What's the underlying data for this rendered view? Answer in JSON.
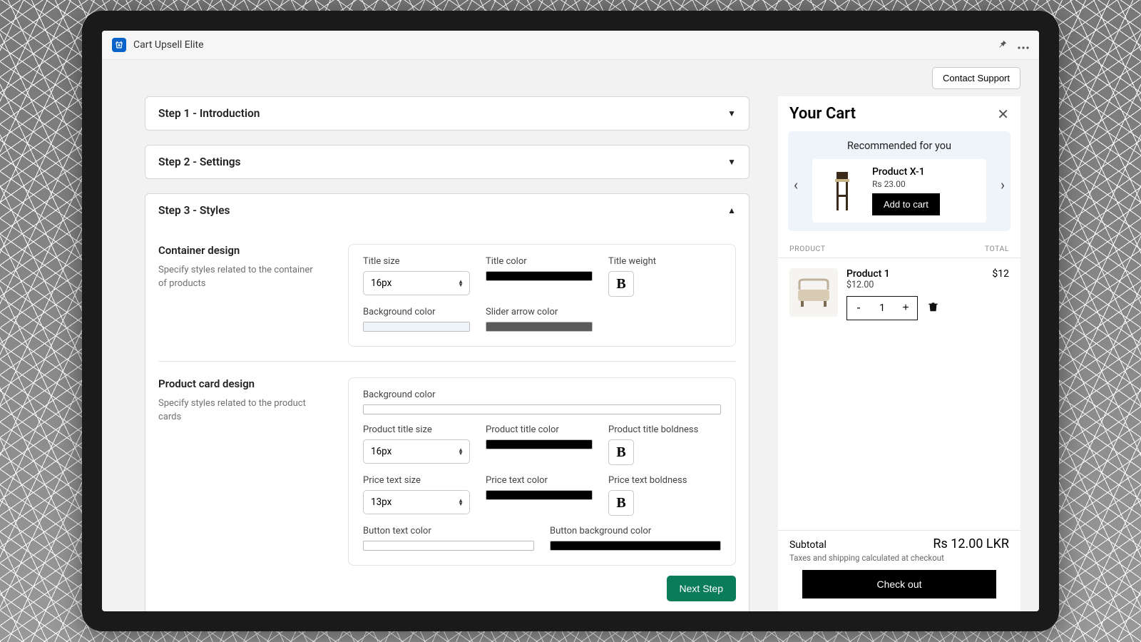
{
  "app": {
    "title": "Cart Upsell Elite"
  },
  "contactSupport": "Contact Support",
  "steps": {
    "s1": "Step 1 - Introduction",
    "s2": "Step 2 - Settings",
    "s3": "Step 3 - Styles"
  },
  "container": {
    "title": "Container design",
    "desc": "Specify styles related to the container of products",
    "fields": {
      "titleSize": {
        "label": "Title size",
        "value": "16px"
      },
      "titleColor": {
        "label": "Title color",
        "value": "#000000"
      },
      "titleWeight": {
        "label": "Title weight"
      },
      "bgColor": {
        "label": "Background color",
        "value": "#eff4fb"
      },
      "arrowColor": {
        "label": "Slider arrow color",
        "value": "#5a5a5a"
      }
    }
  },
  "card": {
    "title": "Product card design",
    "desc": "Specify styles related to the product cards",
    "fields": {
      "bgColor": {
        "label": "Background color",
        "value": "#ffffff"
      },
      "pTitleSize": {
        "label": "Product title size",
        "value": "16px"
      },
      "pTitleColor": {
        "label": "Product title color",
        "value": "#000000"
      },
      "pTitleBold": {
        "label": "Product title boldness"
      },
      "priceSize": {
        "label": "Price text size",
        "value": "13px"
      },
      "priceColor": {
        "label": "Price text color",
        "value": "#000000"
      },
      "priceBold": {
        "label": "Price text boldness"
      },
      "btnText": {
        "label": "Button text color",
        "value": "#ffffff"
      },
      "btnBg": {
        "label": "Button background color",
        "value": "#000000"
      }
    }
  },
  "nextStep": "Next Step",
  "cart": {
    "title": "Your Cart",
    "recTitle": "Recommended for you",
    "rec": {
      "name": "Product X-1",
      "price": "Rs 23.00",
      "addBtn": "Add to cart"
    },
    "colProduct": "PRODUCT",
    "colTotal": "TOTAL",
    "item": {
      "name": "Product 1",
      "price": "$12.00",
      "qty": "1",
      "total": "$12"
    },
    "subtotalLabel": "Subtotal",
    "subtotal": "Rs 12.00 LKR",
    "taxNote": "Taxes and shipping calculated at checkout",
    "checkout": "Check out"
  }
}
